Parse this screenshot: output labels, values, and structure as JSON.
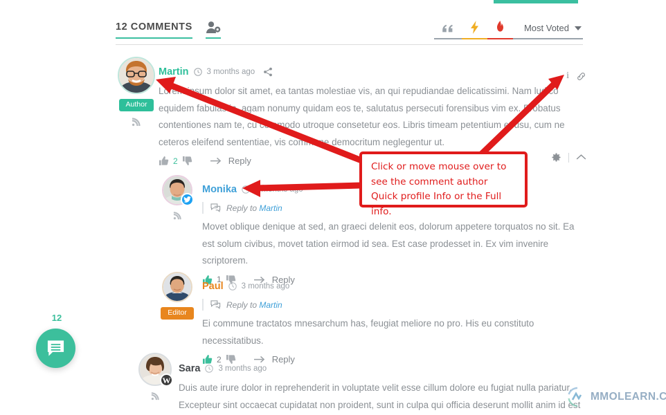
{
  "header": {
    "count_label": "12 COMMENTS",
    "user_icon": "user-settings-icon",
    "tools": [
      {
        "name": "quote-icon",
        "glyph": "“",
        "accent": "#9aa3ab"
      },
      {
        "name": "lightning-icon",
        "glyph": "⚡",
        "accent": "#f0ad22"
      },
      {
        "name": "flame-icon",
        "glyph": "🔥",
        "accent": "#e0392b"
      }
    ],
    "sort_label": "Most Voted"
  },
  "comments": [
    {
      "id": "martin",
      "author": "Martin",
      "time": "3 months ago",
      "role_badge": "Author",
      "text": "Lorem ipsum dolor sit amet, ea tantas molestiae vis, an qui repudiandae delicatissimi. Nam ludico equidem fabulas in, agam nonumy quidam eos te, salutatus persecuti forensibus vim ex. Probatus contentiones nam te, cu commodo utroque consetetur eos. Libris timeam petentium et usu, cum ne ceteros eleifend sententiae, vis commune democritum neglegentur ut.",
      "votes": "2",
      "reply_label": "Reply",
      "reply_to": null,
      "social": null
    },
    {
      "id": "monika",
      "author": "Monika",
      "time": "3 months ago",
      "role_badge": null,
      "text": "Movet oblique denique at sed, an graeci delenit eos, dolorum appetere torquatos no sit. Ea est solum civibus, movet tation eirmod id sea. Est case prodesset in. Ex vim invenire scriptorem.",
      "votes": "1",
      "reply_label": "Reply",
      "reply_to_prefix": "Reply to",
      "reply_to": "Martin",
      "social": "twitter"
    },
    {
      "id": "paul",
      "author": "Paul",
      "time": "3 months ago",
      "role_badge": "Editor",
      "text": "Ei commune tractatos mnesarchum has, feugiat meliore no pro. His eu constituto necessitatibus.",
      "votes": "2",
      "reply_label": "Reply",
      "reply_to_prefix": "Reply to",
      "reply_to": "Martin",
      "social": null
    },
    {
      "id": "sara",
      "author": "Sara",
      "time": "3 months ago",
      "role_badge": null,
      "text": "Duis aute irure dolor in reprehenderit in voluptate velit esse cillum dolore eu fugiat nulla pariatur. Excepteur sint occaecat cupidatat non proident, sunt in culpa qui officia deserunt mollit anim id est",
      "votes": null,
      "reply_label": null,
      "reply_to": null,
      "social": "wordpress"
    }
  ],
  "fab": {
    "count": "12",
    "icon": "comment-bubble-icon"
  },
  "annotation": {
    "callout_text": "Click or move mouse over to see the comment author Quick profile Info or the Full info.",
    "color": "#e01b1b"
  },
  "watermark": {
    "text": "MMOLEARN.COM"
  },
  "theme": {
    "accent": "#3cbf9c",
    "author_green": "#2ebf9a",
    "editor_orange": "#e8861e",
    "link_blue": "#3fa0d8"
  }
}
